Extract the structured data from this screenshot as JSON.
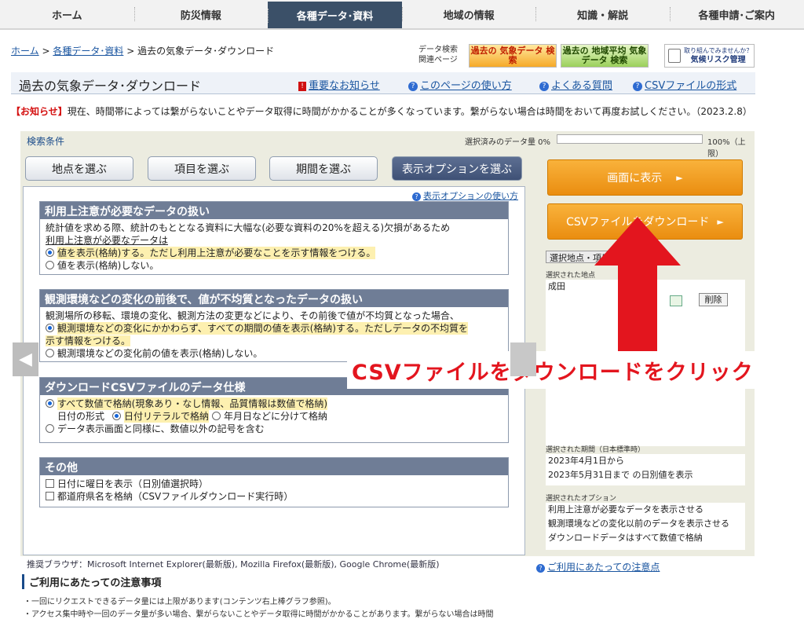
{
  "nav": [
    "ホーム",
    "防災情報",
    "各種データ･資料",
    "地域の情報",
    "知識・解説",
    "各種申請･ご案内"
  ],
  "breadcrumb": {
    "home": "ホーム",
    "sep": ">",
    "data": "各種データ･資料",
    "current": "過去の気象データ･ダウンロード"
  },
  "related": {
    "line1": "データ検索",
    "line2": "関連ページ"
  },
  "banners": {
    "past": "過去の 気象データ 検索",
    "normals": "過去の 地域平均 気象データ 検索",
    "risk_top": "取り組んでみませんか？",
    "risk": "気候リスク管理"
  },
  "title": "過去の気象データ･ダウンロード",
  "title_links": {
    "notice": "重要なお知らせ",
    "usage": "このページの使い方",
    "faq": "よくある質問",
    "csv": "CSVファイルの形式"
  },
  "notice": {
    "tag": "【お知らせ】",
    "text": "現在、時間帯によっては繋がらないことやデータ取得に時間がかかることが多くなっています。繋がらない場合は時間をおいて再度お試しください。（2023.2.8）"
  },
  "search": {
    "label": "検索条件",
    "amount": "選択済みのデータ量 0%",
    "max": "100%（上限）"
  },
  "tabs": {
    "point": "地点を選ぶ",
    "item": "項目を選ぶ",
    "period": "期間を選ぶ",
    "option": "表示オプションを選ぶ"
  },
  "opt_help": "表示オプションの使い方",
  "sections": {
    "s1": {
      "title": "利用上注意が必要なデータの扱い",
      "desc1": "統計値を求める際、統計のもととなる資料に大幅な(必要な資料の20%を超える)欠損があるため",
      "desc2": "利用上注意が必要なデータは",
      "o1": "値を表示(格納)する。ただし利用上注意が必要なことを示す情報をつける。",
      "o2": "値を表示(格納)しない。"
    },
    "s2": {
      "title": "観測環境などの変化の前後で、値が不均質となったデータの扱い",
      "desc": "観測場所の移転、環境の変化、観測方法の変更などにより、その前後で値が不均質となった場合、",
      "o1a": "観測環境などの変化にかかわらず、すべての期間の値を表示(格納)する。ただしデータの不均質を",
      "o1b": "示す情報をつける。",
      "o2": "観測環境などの変化前の値を表示(格納)しない。"
    },
    "s3": {
      "title": "ダウンロードCSVファイルのデータ仕様",
      "o1": "すべて数値で格納(現象あり・なし情報、品質情報は数値で格納)",
      "date_label": "日付の形式",
      "d1": "日付リテラルで格納",
      "d2": "年月日などに分けて格納",
      "o2": "データ表示画面と同様に、数値以外の記号を含む"
    },
    "s4": {
      "title": "その他",
      "c1": "日付に曜日を表示（日別値選択時）",
      "c2": "都道府県名を格納（CSVファイルダウンロード実行時）"
    }
  },
  "buttons": {
    "show": "画面に表示",
    "download": "CSVファイルをダウンロード",
    "arrow": "►"
  },
  "right": {
    "sel_point": "選択地点・項目を",
    "points_label": "選択された地点",
    "point": "成田",
    "delete": "削除",
    "period_label": "選択された期間（日本標準時）",
    "period1": "2023年4月1日から",
    "period2": "2023年5月31日まで の日別値を表示",
    "options_label": "選択されたオプション",
    "opt1": "利用上注意が必要なデータを表示させる",
    "opt2": "観測環境などの変化以前のデータを表示させる",
    "opt3": "ダウンロードデータはすべて数値で格納"
  },
  "overlay": "CSVファイルをダウンロードをクリック",
  "browsers": "推奨ブラウザ：Microsoft Internet Explorer(最新版), Mozilla Firefox(最新版), Google Chrome(最新版)",
  "footer_help": "ご利用にあたっての注意点",
  "caution_title": "ご利用にあたっての注意事項",
  "bullets": [
    "・一回にリクエストできるデータ量には上限があります(コンテンツ右上棒グラフ参照)。",
    "・アクセス集中時や一回のデータ量が多い場合、繋がらないことやデータ取得に時間がかかることがあります。繋がらない場合は時間"
  ],
  "icons": {
    "help": "?",
    "notice": "!",
    "prev": "◀"
  },
  "colors": {
    "accent": "#3b5068",
    "orange": "#ea8d10",
    "red": "#e3151e"
  }
}
